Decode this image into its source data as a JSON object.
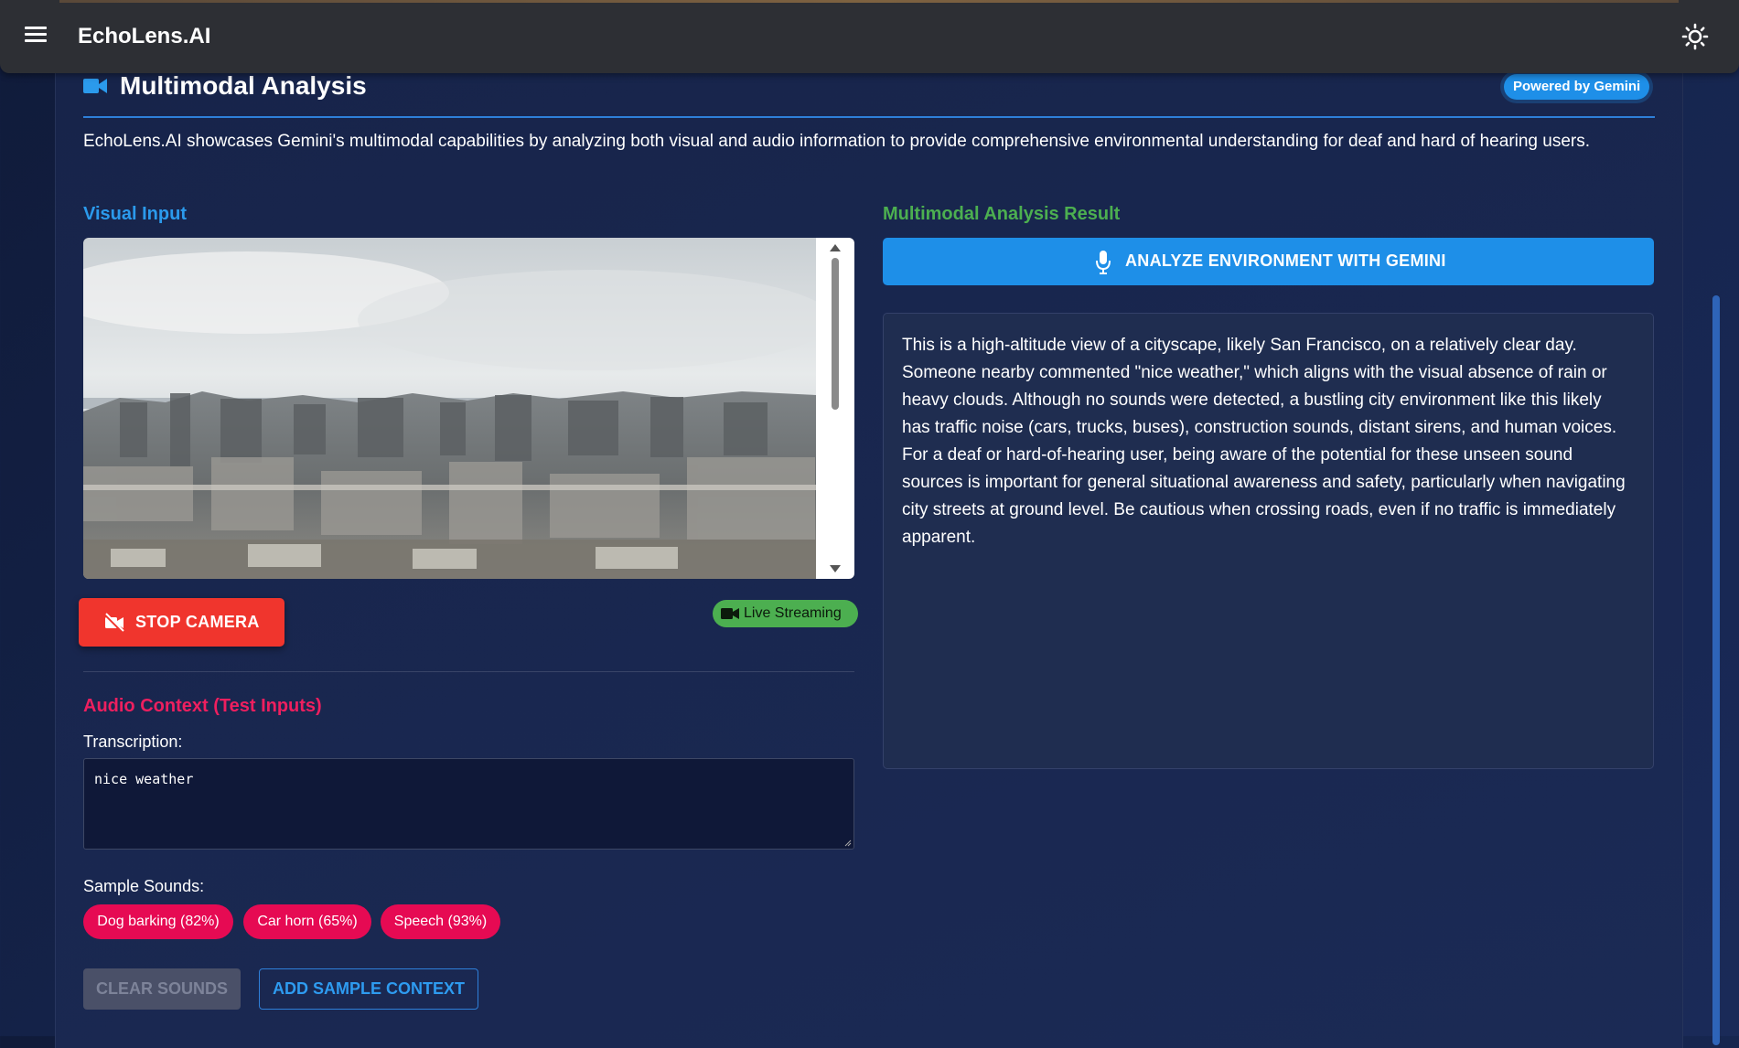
{
  "app": {
    "title": "EchoLens.AI"
  },
  "header": {
    "title": "Multimodal Analysis",
    "badge": "Powered by Gemini",
    "description": "EchoLens.AI showcases Gemini's multimodal capabilities by analyzing both visual and audio information to provide comprehensive environmental understanding for deaf and hard of hearing users."
  },
  "visual": {
    "section_label": "Visual Input",
    "stop_button_label": "STOP CAMERA",
    "live_label": "Live Streaming"
  },
  "audio": {
    "section_label": "Audio Context (Test Inputs)",
    "transcription_label": "Transcription:",
    "transcription_value": "nice weather",
    "sample_sounds_label": "Sample Sounds:",
    "sample_sounds": [
      "Dog barking (82%)",
      "Car horn (65%)",
      "Speech (93%)"
    ],
    "clear_button_label": "CLEAR SOUNDS",
    "add_button_label": "ADD SAMPLE CONTEXT"
  },
  "result": {
    "section_label": "Multimodal Analysis Result",
    "analyze_button_label": "ANALYZE ENVIRONMENT WITH GEMINI",
    "text": "This is a high-altitude view of a cityscape, likely San Francisco, on a relatively clear day. Someone nearby commented \"nice weather,\" which aligns with the visual absence of rain or heavy clouds. Although no sounds were detected, a bustling city environment like this likely has traffic noise (cars, trucks, buses), construction sounds, distant sirens, and human voices. For a deaf or hard-of-hearing user, being aware of the potential for these unseen sound sources is important for general situational awareness and safety, particularly when navigating city streets at ground level. Be cautious when crossing roads, even if no traffic is immediately apparent."
  },
  "icons": {
    "menu": "menu-icon",
    "theme": "sun-icon",
    "title": "videocam-icon",
    "stop": "videocam-off-icon",
    "live": "videocam-icon",
    "analyze": "microphone-icon"
  },
  "colors": {
    "accent_blue": "#1e8fe8",
    "stop_red": "#f0352d",
    "live_green": "#4caf50",
    "chip_pink": "#e60a53",
    "audio_label": "#ee1f5f",
    "result_label": "#4caf50",
    "visual_label": "#2b9aec"
  }
}
